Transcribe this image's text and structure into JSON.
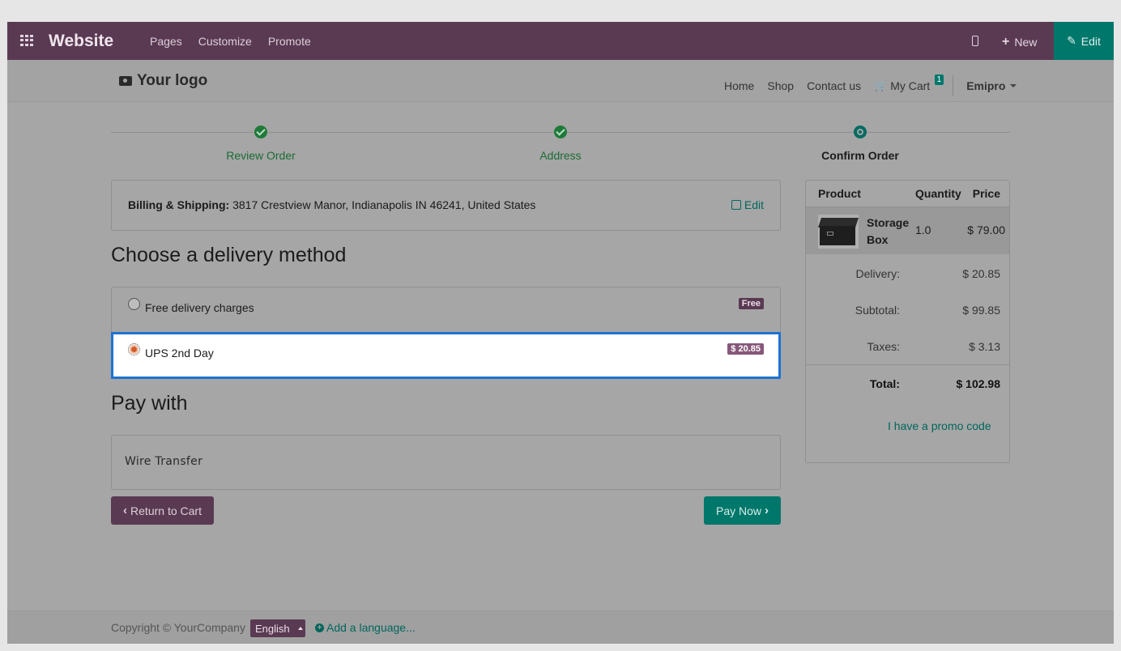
{
  "topbar": {
    "brand": "Website",
    "nav": [
      "Pages",
      "Customize",
      "Promote"
    ],
    "new_label": "New",
    "edit_label": "Edit"
  },
  "header": {
    "logo": "Your logo",
    "nav": {
      "home": "Home",
      "shop": "Shop",
      "contact": "Contact us",
      "cart": "My Cart",
      "cart_count": "1",
      "user": "Emipro"
    }
  },
  "steps": [
    {
      "label": "Review Order",
      "status": "done"
    },
    {
      "label": "Address",
      "status": "done"
    },
    {
      "label": "Confirm Order",
      "status": "current"
    }
  ],
  "billing": {
    "label": "Billing & Shipping:",
    "address": "3817 Crestview Manor, Indianapolis IN 46241, United States",
    "edit_label": "Edit"
  },
  "delivery": {
    "heading": "Choose a delivery method",
    "options": [
      {
        "label": "Free delivery charges",
        "price": "Free",
        "selected": false
      },
      {
        "label": "UPS 2nd Day",
        "price": "$ 20.85",
        "selected": true
      }
    ]
  },
  "payment": {
    "heading": "Pay with",
    "method": "Wire Transfer",
    "return_label": "Return to Cart",
    "pay_label": "Pay Now"
  },
  "summary": {
    "headers": {
      "product": "Product",
      "quantity": "Quantity",
      "price": "Price"
    },
    "product": {
      "name": "Storage Box",
      "quantity": "1.0",
      "price": "$ 79.00"
    },
    "delivery_label": "Delivery:",
    "delivery": "$ 20.85",
    "subtotal_label": "Subtotal:",
    "subtotal": "$ 99.85",
    "taxes_label": "Taxes:",
    "taxes": "$ 3.13",
    "total_label": "Total:",
    "total": "$ 102.98",
    "promo_label": "I have a promo code"
  },
  "footer": {
    "copyright": "Copyright © YourCompany",
    "language": "English",
    "add_language": "Add a language..."
  }
}
